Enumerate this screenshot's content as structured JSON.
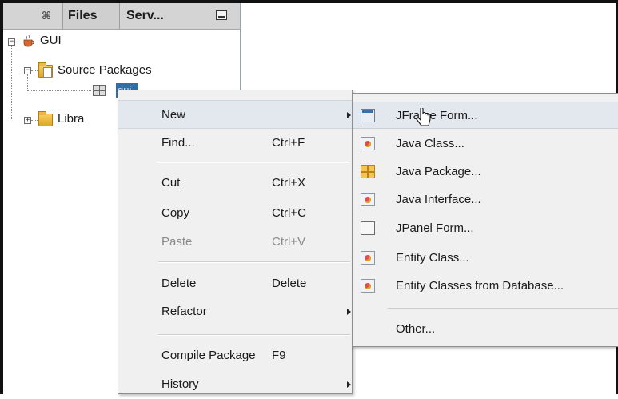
{
  "panel": {
    "tabs": [
      {
        "label": "⌘"
      },
      {
        "label": "Files"
      },
      {
        "label": "Serv..."
      }
    ],
    "tree": {
      "project": "GUI",
      "source_packages": "Source Packages",
      "package_node": "gui",
      "libraries": "Libra"
    }
  },
  "context_menu": {
    "items": [
      {
        "label": "New",
        "shortcut": "",
        "submenu": true
      },
      {
        "label": "Find...",
        "shortcut": "Ctrl+F"
      },
      {
        "label": "Cut",
        "shortcut": "Ctrl+X"
      },
      {
        "label": "Copy",
        "shortcut": "Ctrl+C"
      },
      {
        "label": "Paste",
        "shortcut": "Ctrl+V",
        "disabled": true
      },
      {
        "label": "Delete",
        "shortcut": "Delete"
      },
      {
        "label": "Refactor",
        "shortcut": "",
        "submenu": true
      },
      {
        "label": "Compile Package",
        "shortcut": "F9"
      },
      {
        "label": "History",
        "shortcut": "",
        "submenu": true
      }
    ]
  },
  "new_submenu": {
    "items": [
      {
        "label": "JFrame Form...",
        "icon": "jframe-form-icon"
      },
      {
        "label": "Java Class...",
        "icon": "java-class-icon"
      },
      {
        "label": "Java Package...",
        "icon": "java-package-icon"
      },
      {
        "label": "Java Interface...",
        "icon": "java-interface-icon"
      },
      {
        "label": "JPanel Form...",
        "icon": "jpanel-form-icon"
      },
      {
        "label": "Entity Class...",
        "icon": "entity-class-icon"
      },
      {
        "label": "Entity Classes from Database...",
        "icon": "entity-classes-db-icon"
      },
      {
        "label": "Other...",
        "icon": ""
      }
    ]
  },
  "colors": {
    "selection": "#2f6fa6",
    "menu_bg": "#f0f0f0",
    "menu_highlight": "#e3e8ee",
    "disabled_text": "#8a8a8a"
  }
}
